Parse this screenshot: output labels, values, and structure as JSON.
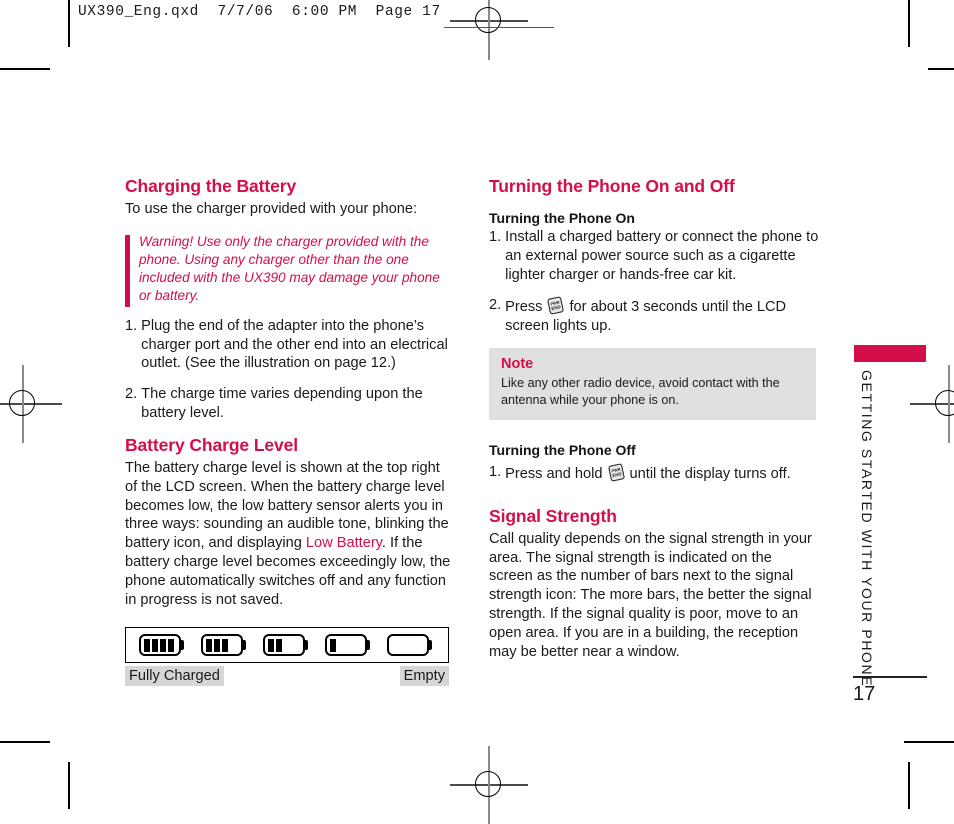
{
  "file_header": {
    "text": "UX390_Eng.qxd  7/7/06  6:00 PM  Page 17"
  },
  "left_column": {
    "heading_charging": "Charging the Battery",
    "intro": "To use the charger provided with your phone:",
    "warning": "Warning! Use only the charger provided with the phone. Using any charger other than the one included with the UX390 may damage your phone or battery.",
    "steps": [
      {
        "num": "1.",
        "text": "Plug the end of the adapter into the phone’s charger port and the other end into an electrical outlet. (See the illustration on page 12.)"
      },
      {
        "num": "2.",
        "text": "The charge time varies depending upon the battery level."
      }
    ],
    "heading_battery_level": "Battery Charge Level",
    "battery_para_1": "The battery charge level is shown at the top right of the LCD screen. When the battery charge level becomes low, the low battery sensor alerts you in three ways: sounding an audible tone, blinking the battery icon, and displaying ",
    "battery_para_accent": "Low Battery",
    "battery_para_2": ". If the battery charge level becomes exceedingly low, the phone automatically switches off and any function in progress is not saved.",
    "battery_diagram": {
      "levels": [
        4,
        3,
        2,
        1,
        0
      ],
      "label_full": "Fully Charged",
      "label_empty": "Empty"
    }
  },
  "right_column": {
    "heading_power": "Turning the Phone On and Off",
    "sub_on": "Turning the Phone On",
    "on_step_1": {
      "num": "1.",
      "text": "Install a charged battery or connect the phone to an external power source such as a cigarette lighter charger or hands-free car kit."
    },
    "on_step_2": {
      "num": "2.",
      "text_before": "Press",
      "key_label": "END",
      "text_after": "for about 3 seconds until the LCD screen lights up."
    },
    "note": {
      "title": "Note",
      "text": "Like any other radio device, avoid contact with the antenna while your phone is on."
    },
    "sub_off": "Turning the Phone Off",
    "off_step_1": {
      "num": "1.",
      "text_before": "Press and hold",
      "key_label": "END",
      "text_after": "until the display turns off."
    },
    "heading_signal": "Signal Strength",
    "signal_para": "Call quality depends on the signal strength in your area. The signal strength is indicated on the screen as the number of bars next to the signal strength icon: The more bars, the better the signal strength. If the signal quality is poor, move to an open area. If you are in a building, the reception may be better near a window."
  },
  "side": {
    "running_head": "GETTING STARTED WITH YOUR PHONE",
    "page_number": "17"
  },
  "colors": {
    "accent": "#d30f4b",
    "note_bg": "#e0e0e0",
    "label_bg": "#d6d6d6",
    "text": "#1a1a1a"
  }
}
